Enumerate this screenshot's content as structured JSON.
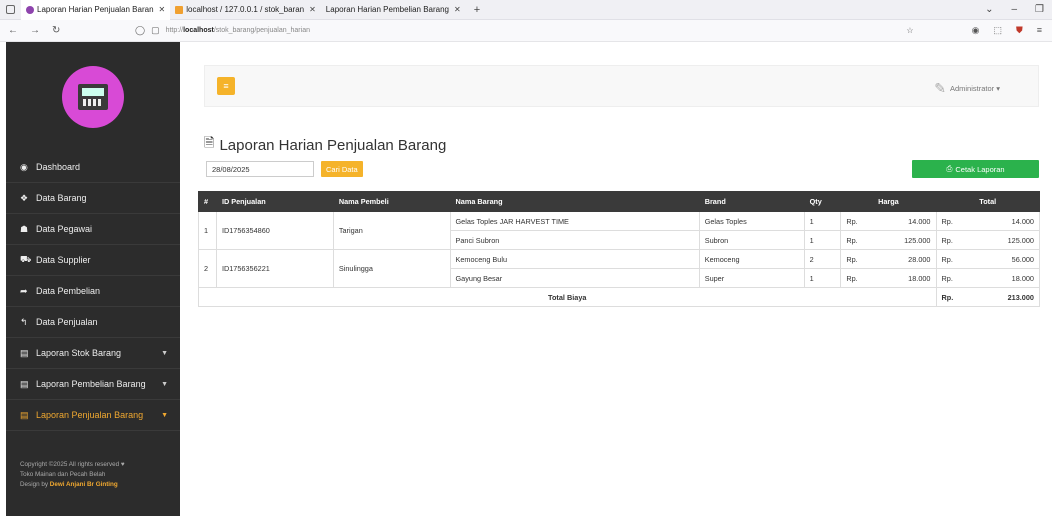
{
  "browser": {
    "tabs": [
      {
        "label": "Laporan Harian Penjualan Baran",
        "active": true
      },
      {
        "label": "localhost / 127.0.0.1 / stok_baran",
        "active": false
      },
      {
        "label": "Laporan Harian Pembelian Barang",
        "active": false
      }
    ],
    "url_prefix": "http://",
    "url_host": "localhost",
    "url_path": "/stok_barang/penjualan_harian"
  },
  "sidebar": {
    "items": [
      {
        "label": "Dashboard",
        "icon": "dashboard-icon",
        "glyph": "◉"
      },
      {
        "label": "Data Barang",
        "icon": "cubes-icon",
        "glyph": "❖"
      },
      {
        "label": "Data Pegawai",
        "icon": "users-icon",
        "glyph": "☗"
      },
      {
        "label": "Data Supplier",
        "icon": "truck-icon",
        "glyph": "⛟"
      },
      {
        "label": "Data Pembelian",
        "icon": "share-icon",
        "glyph": "➦"
      },
      {
        "label": "Data Penjualan",
        "icon": "reply-icon",
        "glyph": "↰"
      },
      {
        "label": "Laporan Stok Barang",
        "icon": "file-icon",
        "glyph": "▤"
      },
      {
        "label": "Laporan Pembelian Barang",
        "icon": "file-icon",
        "glyph": "▤"
      },
      {
        "label": "Laporan Penjualan Barang",
        "icon": "file-icon",
        "glyph": "▤"
      }
    ],
    "footer_line1": "Copyright ©2025 All rights reserved ♥",
    "footer_line2": "Toko Mainan dan Pecah Belah",
    "footer_prefix": "Design by ",
    "footer_author": "Dewi Anjani Br Ginting"
  },
  "topnav": {
    "user": "Administrator ▾"
  },
  "page": {
    "title": "Laporan Harian Penjualan Barang",
    "date_value": "28/08/2025",
    "search_label": "Cari Data",
    "print_label": "Cetak Laporan"
  },
  "table": {
    "headers": [
      "#",
      "ID Penjualan",
      "Nama Pembeli",
      "Nama Barang",
      "Brand",
      "Qty",
      "Harga",
      "Total"
    ],
    "groups": [
      {
        "no": "1",
        "id": "ID1756354860",
        "buyer": "Tarigan",
        "items": [
          {
            "name": "Gelas Toples JAR HARVEST TIME",
            "brand": "Gelas Toples",
            "qty": "1",
            "cur": "Rp.",
            "price": "14.000",
            "cur2": "Rp.",
            "total": "14.000"
          },
          {
            "name": "Panci Subron",
            "brand": "Subron",
            "qty": "1",
            "cur": "Rp.",
            "price": "125.000",
            "cur2": "Rp.",
            "total": "125.000"
          }
        ]
      },
      {
        "no": "2",
        "id": "ID1756356221",
        "buyer": "Sinulingga",
        "items": [
          {
            "name": "Kemoceng Bulu",
            "brand": "Kemoceng",
            "qty": "2",
            "cur": "Rp.",
            "price": "28.000",
            "cur2": "Rp.",
            "total": "56.000"
          },
          {
            "name": "Gayung Besar",
            "brand": "Super",
            "qty": "1",
            "cur": "Rp.",
            "price": "18.000",
            "cur2": "Rp.",
            "total": "18.000"
          }
        ]
      }
    ],
    "footer_label": "Total Biaya",
    "footer_currency": "Rp.",
    "footer_total": "213.000"
  },
  "colors": {
    "accent": "#f5b32a",
    "sidebar": "#2c2c2c",
    "print": "#2bb24c",
    "logo": "#d84ad6"
  }
}
